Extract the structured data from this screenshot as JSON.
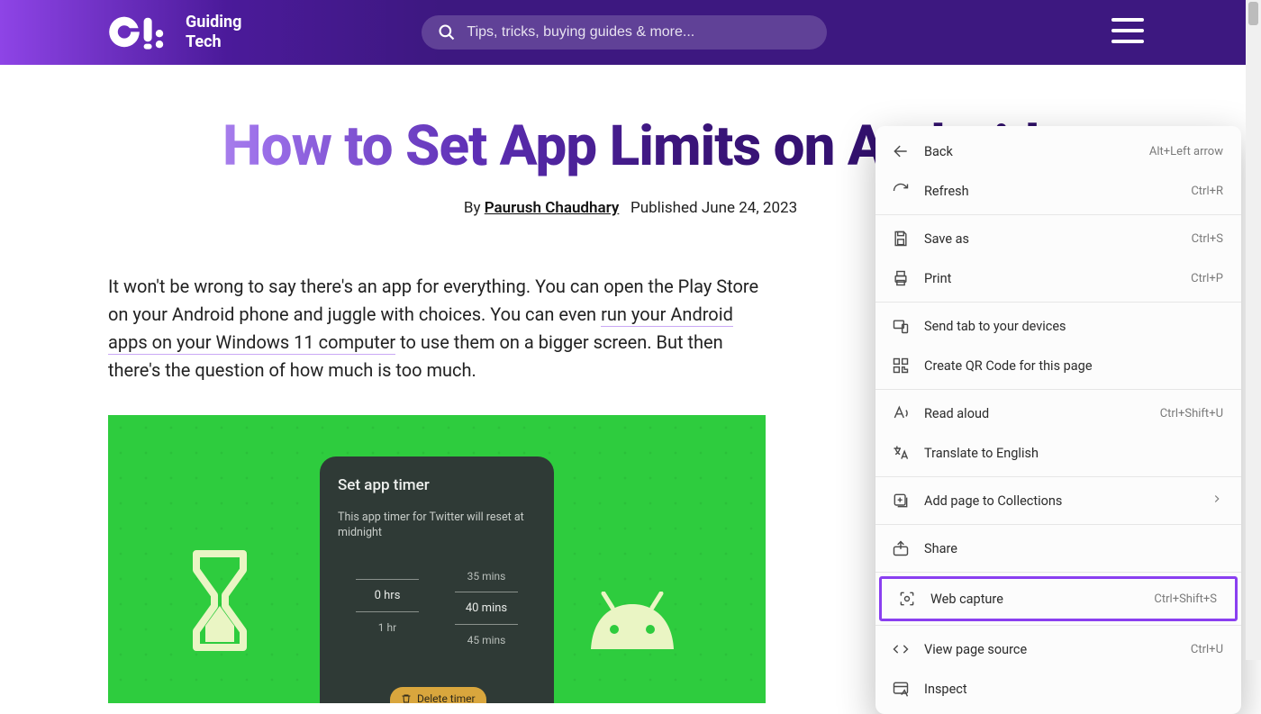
{
  "header": {
    "brand_line1": "Guiding",
    "brand_line2": "Tech",
    "search_placeholder": "Tips, tricks, buying guides & more..."
  },
  "article": {
    "title": "How to Set App Limits on Android",
    "by_prefix": "By ",
    "author": "Paurush Chaudhary",
    "published": "Published June 24, 2023",
    "para_before_link": "It won't be wrong to say there's an app for everything. You can open the Play Store on your Android phone and juggle with choices. You can even ",
    "para_link": "run your Android apps on your Windows 11 computer",
    "para_after_link": " to use them on a bigger screen. But then there's the question of how much is too much."
  },
  "feature": {
    "card_title": "Set app timer",
    "card_sub": "This app timer for Twitter will reset at midnight",
    "wheel": {
      "top": [
        "",
        "35 mins"
      ],
      "mid": [
        "0 hrs",
        "40 mins"
      ],
      "bot": [
        "1 hr",
        "45 mins"
      ]
    },
    "delete": "Delete timer"
  },
  "contextmenu": {
    "items": [
      {
        "icon": "back",
        "label": "Back",
        "shortcut": "Alt+Left arrow"
      },
      {
        "icon": "refresh",
        "label": "Refresh",
        "shortcut": "Ctrl+R"
      },
      {
        "sep": true
      },
      {
        "icon": "saveas",
        "label": "Save as",
        "shortcut": "Ctrl+S"
      },
      {
        "icon": "print",
        "label": "Print",
        "shortcut": "Ctrl+P"
      },
      {
        "sep": true
      },
      {
        "icon": "sendtab",
        "label": "Send tab to your devices",
        "shortcut": ""
      },
      {
        "icon": "qr",
        "label": "Create QR Code for this page",
        "shortcut": ""
      },
      {
        "sep": true
      },
      {
        "icon": "read",
        "label": "Read aloud",
        "shortcut": "Ctrl+Shift+U"
      },
      {
        "icon": "translate",
        "label": "Translate to English",
        "shortcut": ""
      },
      {
        "sep": true
      },
      {
        "icon": "collections",
        "label": "Add page to Collections",
        "shortcut": "",
        "chevron": true
      },
      {
        "sep": true
      },
      {
        "icon": "share",
        "label": "Share",
        "shortcut": ""
      },
      {
        "sep": true
      },
      {
        "icon": "webcapture",
        "label": "Web capture",
        "shortcut": "Ctrl+Shift+S",
        "highlight": true
      },
      {
        "sep": true
      },
      {
        "icon": "viewsource",
        "label": "View page source",
        "shortcut": "Ctrl+U"
      },
      {
        "icon": "inspect",
        "label": "Inspect",
        "shortcut": ""
      }
    ]
  }
}
